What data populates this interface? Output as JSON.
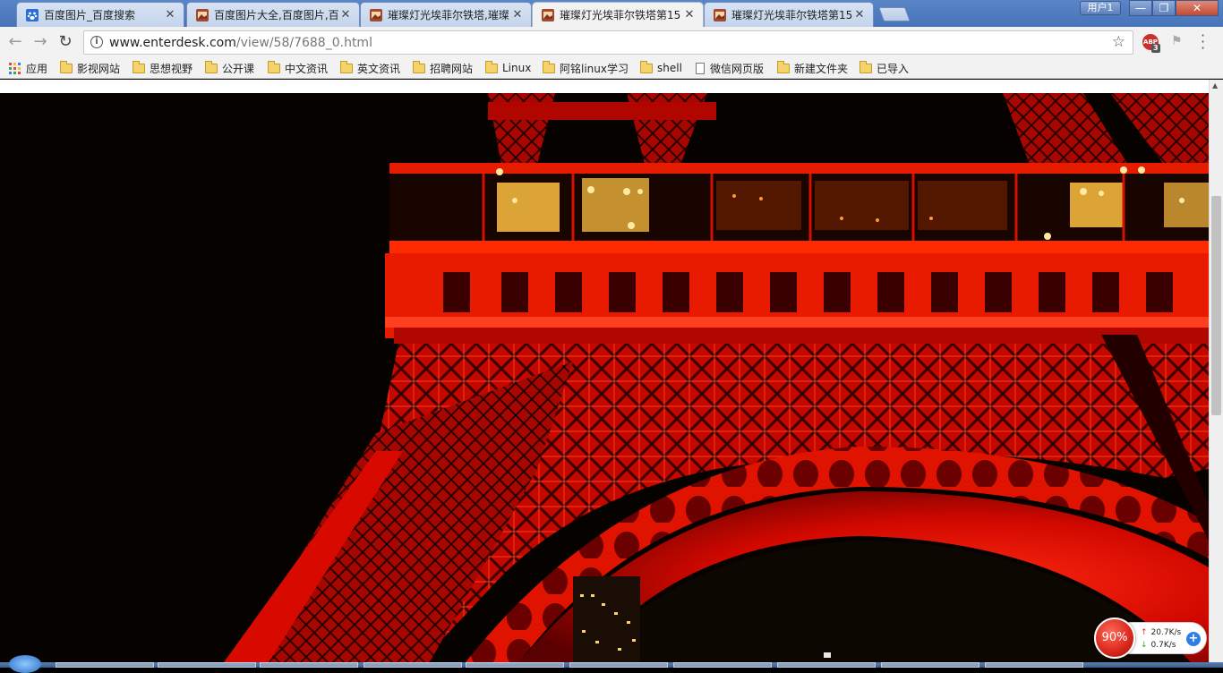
{
  "window": {
    "user_label": "用户1",
    "min_label": "—",
    "max_label": "❐",
    "close_label": "✕"
  },
  "tabs": [
    {
      "title": "百度图片_百度搜索",
      "favicon": "baidu-paw-icon",
      "active": false
    },
    {
      "title": "百度图片大全,百度图片,百",
      "favicon": "image-favicon",
      "active": false
    },
    {
      "title": "璀璨灯光埃菲尔铁塔,璀璨",
      "favicon": "image-favicon",
      "active": false
    },
    {
      "title": "璀璨灯光埃菲尔铁塔第15",
      "favicon": "image-favicon",
      "active": true
    },
    {
      "title": "璀璨灯光埃菲尔铁塔第15",
      "favicon": "image-favicon",
      "active": false
    }
  ],
  "tab_close": "✕",
  "toolbar": {
    "back": "←",
    "forward": "→",
    "reload": "↻",
    "url_host": "www.enterdesk.com",
    "url_path": "/view/58/7688_0.html",
    "star": "☆",
    "abp_label": "ABP",
    "abp_count": "3"
  },
  "bookmarks": [
    {
      "label": "应用",
      "icon": "apps-grid-icon"
    },
    {
      "label": "影视网站",
      "icon": "folder-icon"
    },
    {
      "label": "思想视野",
      "icon": "folder-icon"
    },
    {
      "label": "公开课",
      "icon": "folder-icon"
    },
    {
      "label": "中文资讯",
      "icon": "folder-icon"
    },
    {
      "label": "英文资讯",
      "icon": "folder-icon"
    },
    {
      "label": "招聘网站",
      "icon": "folder-icon"
    },
    {
      "label": "Linux",
      "icon": "folder-icon"
    },
    {
      "label": "阿铭linux学习",
      "icon": "folder-icon"
    },
    {
      "label": "shell",
      "icon": "folder-icon"
    },
    {
      "label": "微信网页版",
      "icon": "page-icon"
    },
    {
      "label": "新建文件夹",
      "icon": "folder-icon"
    },
    {
      "label": "已导入",
      "icon": "folder-icon"
    }
  ],
  "speed_widget": {
    "percent": "90%",
    "upload": "20.7K/s",
    "download": "0.7K/s",
    "plus": "+"
  }
}
